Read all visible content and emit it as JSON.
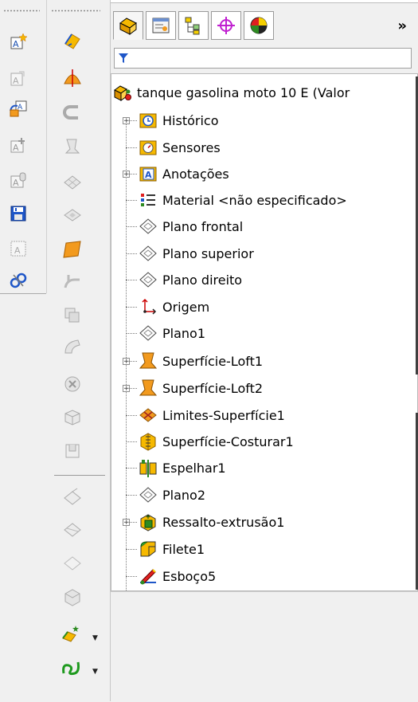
{
  "left_toolbar": {
    "icons": [
      "annotation-star-icon",
      "annotation-disabled-icon",
      "annotation-swap-icon",
      "annotation-add-icon",
      "annotation-lock-icon",
      "save-floppy-icon",
      "annotation-frame-icon",
      "link-tools-icon"
    ]
  },
  "surface_toolbar": {
    "icons": [
      "extruded-surface-icon",
      "revolved-surface-icon",
      "swept-surface-icon",
      "lofted-surface-icon",
      "boundary-surface-icon",
      "filled-surface-icon",
      "planar-surface-icon",
      "offset-surface-icon",
      "ruled-surface-icon",
      "surface-flatten-icon",
      "delete-face-icon",
      "replace-face-icon",
      "delete-hole-icon",
      "extend-surface-icon",
      "trim-surface-icon",
      "untrim-surface-icon",
      "knit-surface-icon",
      "thicken-icon",
      "thickened-cut-icon",
      "cut-with-surface-icon"
    ]
  },
  "feature_manager": {
    "tabs": [
      "featuremanager-tab-icon",
      "propertymanager-tab-icon",
      "configurationmanager-tab-icon",
      "dimxpert-tab-icon",
      "display-manager-tab-icon"
    ],
    "more_label": "»",
    "filter_placeholder": "",
    "root": "tanque gasolina moto 10 E  (Valor",
    "items": [
      {
        "label": "Histórico"
      },
      {
        "label": "Sensores"
      },
      {
        "label": "Anotações"
      },
      {
        "label": "Material <não especificado>"
      },
      {
        "label": "Plano frontal"
      },
      {
        "label": "Plano superior"
      },
      {
        "label": "Plano direito"
      },
      {
        "label": "Origem"
      },
      {
        "label": "Plano1"
      },
      {
        "label": "Superfície-Loft1"
      },
      {
        "label": "Superfície-Loft2"
      },
      {
        "label": "Limites-Superfície1"
      },
      {
        "label": "Superfície-Costurar1"
      },
      {
        "label": "Espelhar1"
      },
      {
        "label": "Plano2"
      },
      {
        "label": "Ressalto-extrusão1"
      },
      {
        "label": "Filete1"
      },
      {
        "label": "Esboço5"
      }
    ]
  },
  "colors": {
    "accent_yellow": "#f6b900",
    "blue": "#1e56c8",
    "orange": "#f29a1e",
    "green": "#2e8b22"
  }
}
